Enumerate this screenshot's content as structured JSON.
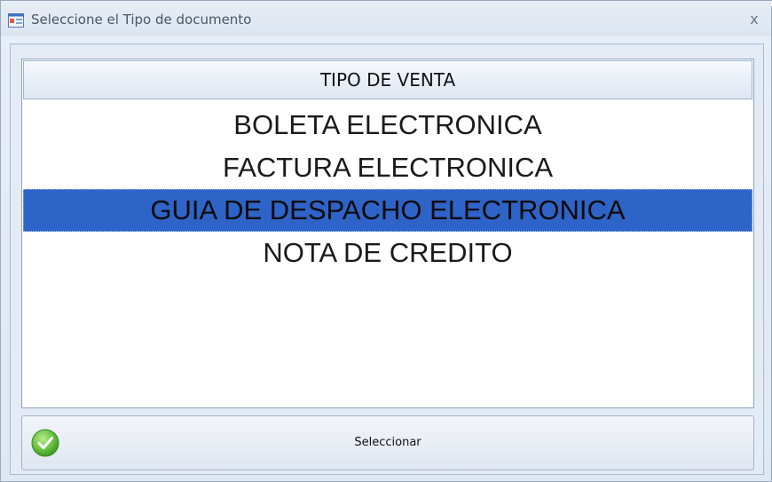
{
  "window": {
    "title": "Seleccione el Tipo de documento",
    "close_label": "x"
  },
  "list": {
    "header": "TIPO DE VENTA",
    "items": [
      {
        "label": "BOLETA ELECTRONICA",
        "selected": false
      },
      {
        "label": "FACTURA ELECTRONICA",
        "selected": false
      },
      {
        "label": "GUIA DE DESPACHO ELECTRONICA",
        "selected": true
      },
      {
        "label": "NOTA DE CREDITO",
        "selected": false
      }
    ],
    "selected_color": "#2e63c7"
  },
  "action": {
    "button_label": "Seleccionar",
    "icon": "check-icon",
    "icon_color": "#5cb83a"
  }
}
